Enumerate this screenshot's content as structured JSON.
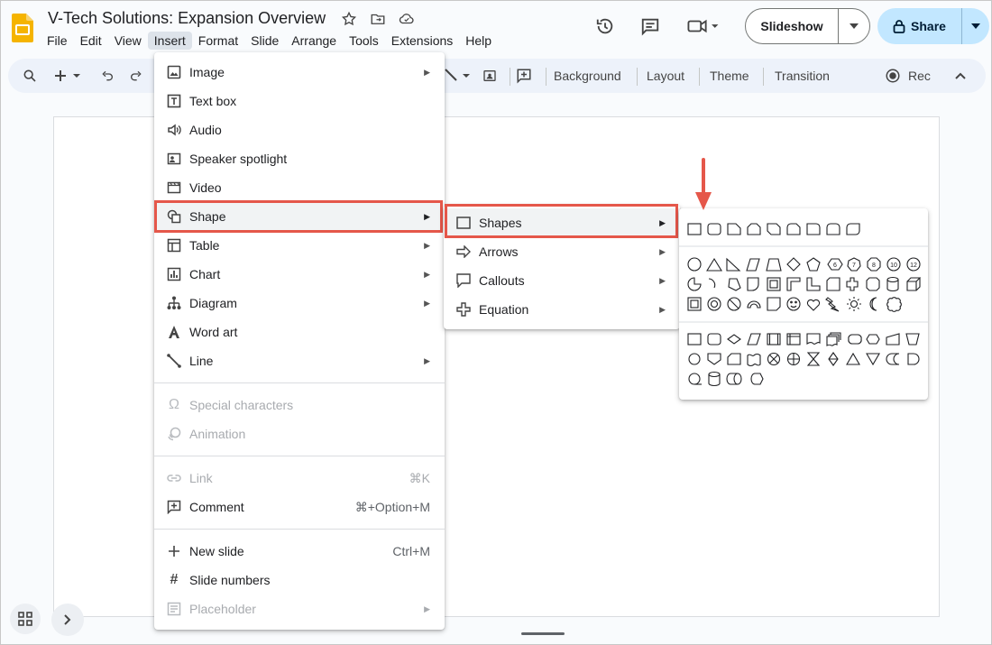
{
  "app": {
    "doc_title": "V-Tech Solutions: Expansion Overview",
    "menubar": [
      "File",
      "Edit",
      "View",
      "Insert",
      "Format",
      "Slide",
      "Arrange",
      "Tools",
      "Extensions",
      "Help"
    ],
    "active_menu": "Insert",
    "slideshow_label": "Slideshow",
    "share_label": "Share"
  },
  "toolbar": {
    "background": "Background",
    "layout": "Layout",
    "theme": "Theme",
    "transition": "Transition",
    "rec": "Rec"
  },
  "insert_menu": {
    "items": [
      {
        "label": "Image",
        "icon": "image-icon",
        "submenu": true
      },
      {
        "label": "Text box",
        "icon": "textbox-icon"
      },
      {
        "label": "Audio",
        "icon": "audio-icon"
      },
      {
        "label": "Speaker spotlight",
        "icon": "speaker-spotlight-icon"
      },
      {
        "label": "Video",
        "icon": "video-icon"
      },
      {
        "label": "Shape",
        "icon": "shape-icon",
        "submenu": true
      },
      {
        "label": "Table",
        "icon": "table-icon",
        "submenu": true
      },
      {
        "label": "Chart",
        "icon": "chart-icon",
        "submenu": true
      },
      {
        "label": "Diagram",
        "icon": "diagram-icon",
        "submenu": true
      },
      {
        "label": "Word art",
        "icon": "word-art-icon"
      },
      {
        "label": "Line",
        "icon": "line-icon",
        "submenu": true
      },
      {
        "label": "Special characters",
        "icon": "omega-icon",
        "disabled": true
      },
      {
        "label": "Animation",
        "icon": "animation-icon",
        "disabled": true
      },
      {
        "label": "Link",
        "icon": "link-icon",
        "disabled": true,
        "shortcut": "⌘K"
      },
      {
        "label": "Comment",
        "icon": "comment-icon",
        "shortcut": "⌘+Option+M"
      },
      {
        "label": "New slide",
        "icon": "plus-icon",
        "shortcut": "Ctrl+M"
      },
      {
        "label": "Slide numbers",
        "icon": "hash-icon"
      },
      {
        "label": "Placeholder",
        "icon": "placeholder-icon",
        "disabled": true,
        "submenu": true
      }
    ]
  },
  "shape_submenu": {
    "items": [
      {
        "label": "Shapes",
        "icon": "rectangle-icon"
      },
      {
        "label": "Arrows",
        "icon": "arrow-right-icon"
      },
      {
        "label": "Callouts",
        "icon": "callout-icon"
      },
      {
        "label": "Equation",
        "icon": "equation-plus-icon"
      }
    ]
  },
  "colors": {
    "highlight_box": "#e5574a",
    "share_bg": "#c2e7ff",
    "toolbar_bg": "#edf2fa"
  }
}
